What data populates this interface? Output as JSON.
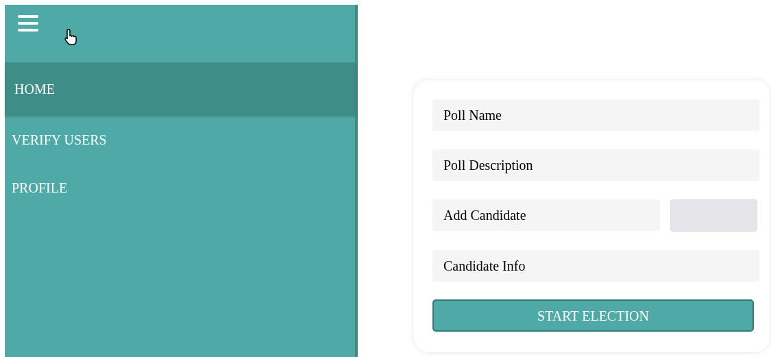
{
  "sidebar": {
    "items": [
      {
        "label": "HOME",
        "selected": true
      },
      {
        "label": "VERIFY USERS",
        "selected": false
      },
      {
        "label": "PROFILE",
        "selected": false
      }
    ]
  },
  "form": {
    "fields": [
      {
        "kind": "text",
        "placeholder": "Poll Name"
      },
      {
        "kind": "text",
        "placeholder": "Poll Description"
      },
      {
        "kind": "with-button",
        "placeholder": "Add Candidate"
      },
      {
        "kind": "text",
        "placeholder": "Candidate Info"
      }
    ],
    "submit": "START ELECTION"
  }
}
